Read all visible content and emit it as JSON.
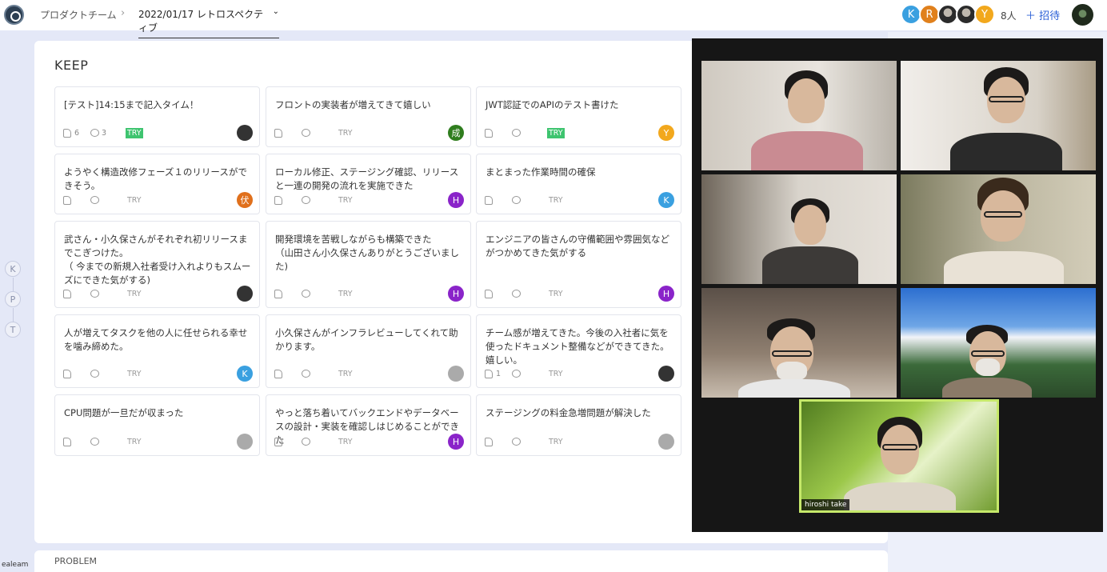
{
  "header": {
    "team_name": "プロダクトチーム",
    "separator": "›",
    "event_name": "2022/01/17 レトロスペクティブ",
    "member_count": "8人",
    "invite_label": "＋ 招待",
    "avatars": [
      {
        "initial": "K",
        "color": "#3aa0e0"
      },
      {
        "initial": "R",
        "color": "#e0801c"
      },
      {
        "initial": "",
        "color": "photo"
      },
      {
        "initial": "",
        "color": "photo"
      },
      {
        "initial": "Y",
        "color": "#f2a81d"
      }
    ]
  },
  "kpt_nav": [
    "K",
    "P",
    "T"
  ],
  "keep": {
    "title": "KEEP",
    "cards": [
      {
        "text": "[テスト]14:15まで記入タイム！",
        "likes": "6",
        "comments": "3",
        "try": "TRY",
        "try_on": true,
        "author": "",
        "author_color": "#333"
      },
      {
        "text": "フロントの実装者が増えてきて嬉しい",
        "likes": "",
        "comments": "",
        "try": "TRY",
        "try_on": false,
        "author": "成",
        "author_color": "#2f7d1e"
      },
      {
        "text": "JWT認証でのAPIのテスト書けた",
        "likes": "",
        "comments": "",
        "try": "TRY",
        "try_on": true,
        "author": "Y",
        "author_color": "#f2a81d"
      },
      {
        "text": "ようやく構造改修フェーズ１のリリースができそう。",
        "likes": "",
        "comments": "",
        "try": "TRY",
        "try_on": false,
        "author": "伏",
        "author_color": "#e0701c"
      },
      {
        "text": "ローカル修正、ステージング確認、リリースと一連の開発の流れを実施できた",
        "likes": "",
        "comments": "",
        "try": "TRY",
        "try_on": false,
        "author": "H",
        "author_color": "#8a24c9"
      },
      {
        "text": "まとまった作業時間の確保",
        "likes": "",
        "comments": "",
        "try": "TRY",
        "try_on": false,
        "author": "K",
        "author_color": "#3aa0e0"
      },
      {
        "text": "武さん・小久保さんがそれぞれ初リリースまでこぎつけた。\n（ 今までの新規入社者受け入れよりもスムーズにできた気がする)",
        "likes": "",
        "comments": "",
        "try": "TRY",
        "try_on": false,
        "author": "",
        "author_color": "#333"
      },
      {
        "text": "開発環境を苦戦しながらも構築できた\n（山田さん小久保さんありがとうございました)",
        "likes": "",
        "comments": "",
        "try": "TRY",
        "try_on": false,
        "author": "H",
        "author_color": "#8a24c9"
      },
      {
        "text": "エンジニアの皆さんの守備範囲や雰囲気などがつかめてきた気がする",
        "likes": "",
        "comments": "",
        "try": "TRY",
        "try_on": false,
        "author": "H",
        "author_color": "#8a24c9"
      },
      {
        "text": "人が増えてタスクを他の人に任せられる幸せを噛み締めた。",
        "likes": "",
        "comments": "",
        "try": "TRY",
        "try_on": false,
        "author": "K",
        "author_color": "#3aa0e0"
      },
      {
        "text": "小久保さんがインフラレビューしてくれて助かります。",
        "likes": "",
        "comments": "",
        "try": "TRY",
        "try_on": false,
        "author": "",
        "author_color": "#aaa"
      },
      {
        "text": "チーム感が増えてきた。今後の入社者に気を使ったドキュメント整備などができてきた。嬉しい。",
        "likes": "1",
        "comments": "",
        "try": "TRY",
        "try_on": false,
        "author": "",
        "author_color": "#333"
      },
      {
        "text": "CPU問題が一旦だが収まった",
        "likes": "",
        "comments": "",
        "try": "TRY",
        "try_on": false,
        "author": "",
        "author_color": "#aaa"
      },
      {
        "text": "やっと落ち着いてバックエンドやデータベースの設計・実装を確認しはじめることができた",
        "likes": "",
        "comments": "",
        "try": "TRY",
        "try_on": false,
        "author": "H",
        "author_color": "#8a24c9"
      },
      {
        "text": "ステージングの料金急増問題が解決した",
        "likes": "",
        "comments": "",
        "try": "TRY",
        "try_on": false,
        "author": "",
        "author_color": "#aaa"
      }
    ]
  },
  "problem": {
    "title": "PROBLEM"
  },
  "footer_tag": "ealeam",
  "video_call": {
    "active_speaker_name": "hiroshi take"
  }
}
